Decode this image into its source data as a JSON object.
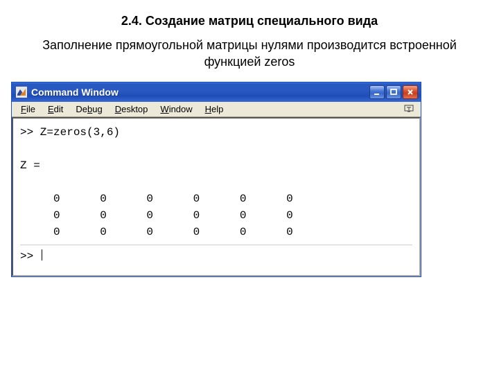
{
  "heading": "2.4. Создание матриц специального вида",
  "description": "Заполнение прямоугольной матрицы нулями производится встроенной функцией zeros",
  "window": {
    "title": "Command Window",
    "menu": {
      "file": "File",
      "edit": "Edit",
      "debug": "Debug",
      "desktop": "Desktop",
      "window": "Window",
      "help": "Help"
    },
    "console": {
      "prompt": ">>",
      "command": "Z=zeros(3,6)",
      "result_label": "Z =",
      "matrix": [
        [
          0,
          0,
          0,
          0,
          0,
          0
        ],
        [
          0,
          0,
          0,
          0,
          0,
          0
        ],
        [
          0,
          0,
          0,
          0,
          0,
          0
        ]
      ]
    }
  }
}
